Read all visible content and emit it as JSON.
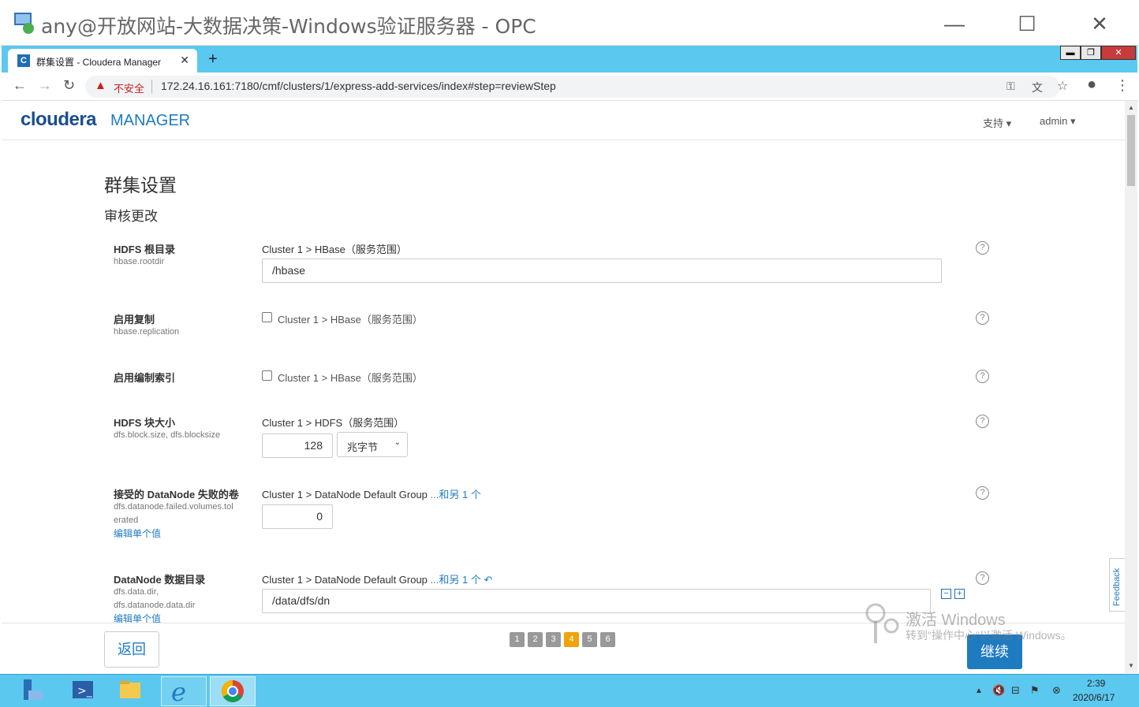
{
  "window": {
    "title": "any@开放网站-大数据决策-Windows验证服务器 - OPC"
  },
  "browser": {
    "tab_title": "群集设置 - Cloudera Manager",
    "tab_favicon": "C",
    "insecure_label": "不安全",
    "url": "172.24.16.161:7180/cmf/clusters/1/express-add-services/index#step=reviewStep"
  },
  "header": {
    "logo": "cloudera",
    "logo_sub": "MANAGER",
    "support_menu": "支持 ▾",
    "user_menu": "admin ▾"
  },
  "page": {
    "title": "群集设置",
    "subtitle": "审核更改"
  },
  "rows": [
    {
      "label": "HDFS 根目录",
      "key": "hbase.rootdir",
      "scope": "Cluster 1 > HBase（服务范围）",
      "value": "/hbase"
    },
    {
      "label": "启用复制",
      "key": "hbase.replication",
      "scope": "Cluster 1 > HBase（服务范围）"
    },
    {
      "label": "启用编制索引",
      "key": "",
      "scope": "Cluster 1 > HBase（服务范围）"
    },
    {
      "label": "HDFS 块大小",
      "key": "dfs.block.size, dfs.blocksize",
      "scope": "Cluster 1 > HDFS（服务范围）",
      "value": "128",
      "unit": "兆字节"
    },
    {
      "label": "接受的 DataNode 失败的卷",
      "key_line1": "dfs.datanode.failed.volumes.tol",
      "key_line2": "erated",
      "scope": "Cluster 1 > DataNode Default Group",
      "scope_more": "...和另 1 个",
      "value": "0",
      "edit": "编辑单个值"
    },
    {
      "label": "DataNode 数据目录",
      "key_line1": "dfs.data.dir,",
      "key_line2": "dfs.datanode.data.dir",
      "scope": "Cluster 1 > DataNode Default Group",
      "scope_more": "...和另 1 个",
      "value": "/data/dfs/dn",
      "edit": "编辑单个值"
    }
  ],
  "help_symbol": "?",
  "actions": {
    "back": "返回",
    "continue": "继续",
    "pages": [
      "1",
      "2",
      "3",
      "4",
      "5",
      "6"
    ],
    "current_page": "4"
  },
  "watermark": {
    "line1": "激活 Windows",
    "line2": "转到\"操作中心\"以激活 Windows。"
  },
  "feedback": "Feedback",
  "taskbar": {
    "time": "2:39",
    "date": "2020/6/17"
  },
  "colors": {
    "accent": "#1f7bc0",
    "taskbar": "#5bc8ef",
    "pager_active": "#f0a30a"
  }
}
